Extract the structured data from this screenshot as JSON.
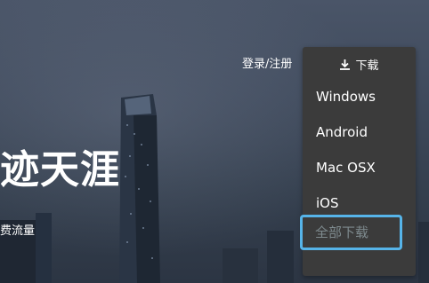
{
  "header": {
    "login_register": "登录/注册"
  },
  "download_menu": {
    "toggle_label": "下载",
    "items": [
      {
        "label": "Windows"
      },
      {
        "label": "Android"
      },
      {
        "label": "Mac OSX"
      },
      {
        "label": "iOS"
      },
      {
        "label": "全部下载",
        "focused": true
      }
    ]
  },
  "hero": {
    "title": "迹天涯",
    "subtitle": "费流量"
  },
  "colors": {
    "menu_background": "#3b3b3b",
    "focus_ring": "#56b4e9",
    "dimmed_item_text": "#7e8a8e",
    "text": "#ffffff"
  }
}
